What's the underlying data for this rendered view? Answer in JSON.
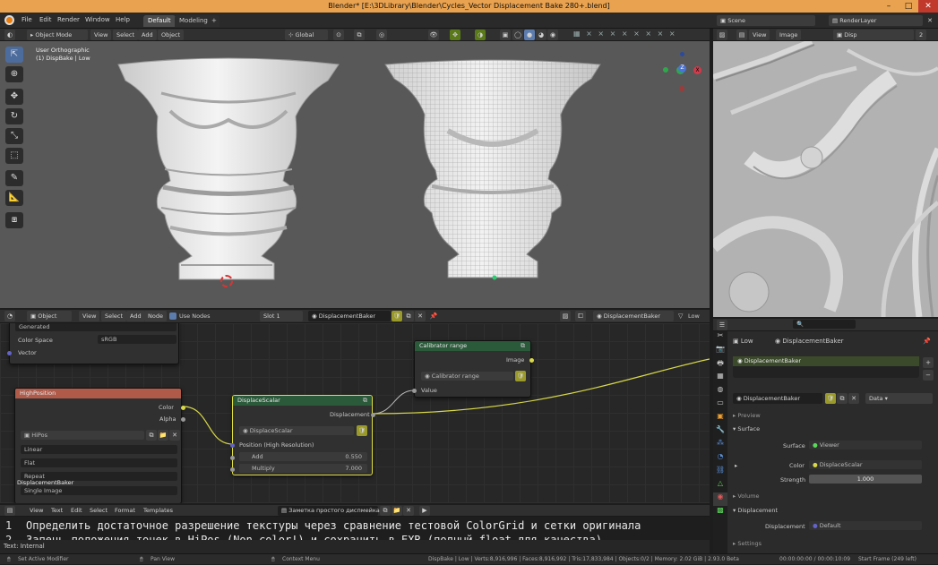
{
  "window": {
    "title": "Blender* [E:\\3DLibrary\\Blender\\Cycles_Vector Displacement Bake 280+.blend]",
    "accent": "#e9a24f"
  },
  "menu": {
    "items": [
      "File",
      "Edit",
      "Render",
      "Window",
      "Help"
    ],
    "workspaces": [
      "Default",
      "Modeling"
    ],
    "scene": "Scene",
    "view_layer": "RenderLayer"
  },
  "viewport": {
    "mode": "Object Mode",
    "menus": [
      "View",
      "Select",
      "Add",
      "Object"
    ],
    "orientation": "Global",
    "overlay_line1": "User Orthographic",
    "overlay_line2": "(1) DispBake | Low",
    "gizmo_axes": [
      "X",
      "Y",
      "Z"
    ]
  },
  "image_editor": {
    "menus": [
      "View",
      "Image"
    ],
    "image_name": "Disp",
    "slot": "2"
  },
  "node_editor": {
    "type": "Object",
    "menus": [
      "View",
      "Select",
      "Add",
      "Node"
    ],
    "use_nodes_label": "Use Nodes",
    "slot": "Slot 1",
    "material": "DisplacementBaker",
    "material2": "DisplacementBaker",
    "level": "Low",
    "texcoord_node": {
      "output": "Generated",
      "color_space_label": "Color Space",
      "color_space_value": "sRGB",
      "socket_vector": "Vector"
    },
    "image_node": {
      "title": "HighPosition",
      "out_color": "Color",
      "out_alpha": "Alpha",
      "image": "HiPos",
      "interpolation": "Linear",
      "projection": "Flat",
      "extension": "Repeat",
      "source": "Single Image",
      "label": "DisplacementBaker"
    },
    "displace_node": {
      "title": "DisplaceScalar",
      "out": "Displacement",
      "group": "DisplaceScalar",
      "in_position": "Position (High Resolution)",
      "add_label": "Add",
      "add_value": "0.550",
      "mult_label": "Multiply",
      "mult_value": "7.000"
    },
    "calib_node": {
      "title": "Calibrator range",
      "out": "Image",
      "group": "Calibrator range",
      "in": "Value"
    }
  },
  "text_editor": {
    "menus": [
      "View",
      "Text",
      "Edit",
      "Select",
      "Format",
      "Templates"
    ],
    "file": "Заметка простого диспмейка",
    "line1_num": "1",
    "line1": "Определить достаточное разрешение текстуры через сравнение тестовой ColorGrid и сетки оригинала",
    "line2_num": "2",
    "line2": "Запечь положения точек в HiPos (Non color!) и сохранить в EXR (полный float для качества)",
    "footer": "Text: Internal"
  },
  "properties": {
    "object": "Low",
    "material": "DisplacementBaker",
    "slot_item": "DisplacementBaker",
    "material_field": "DisplacementBaker",
    "data_label": "Data",
    "sections": {
      "preview": "Preview",
      "surface": "Surface",
      "volume": "Volume",
      "displacement": "Displacement",
      "settings": "Settings"
    },
    "surface_label": "Surface",
    "surface_value": "Viewer",
    "color_label": "Color",
    "color_value": "DisplaceScalar",
    "strength_label": "Strength",
    "strength_value": "1.000",
    "displacement_label": "Displacement",
    "displacement_value": "Default"
  },
  "status": {
    "left": "Set Active Modifier",
    "mid1": "Pan View",
    "mid2": "Context Menu",
    "stats": "DispBake | Low | Verts:8,916,996 | Faces:8,916,992 | Tris:17,833,984 | Objects:0/2 | Memory: 2.02 GiB | 2.93.0 Beta",
    "timecode": "00:00:00:00 / 00:00:10:09",
    "frame": "Start Frame (249 left)"
  }
}
